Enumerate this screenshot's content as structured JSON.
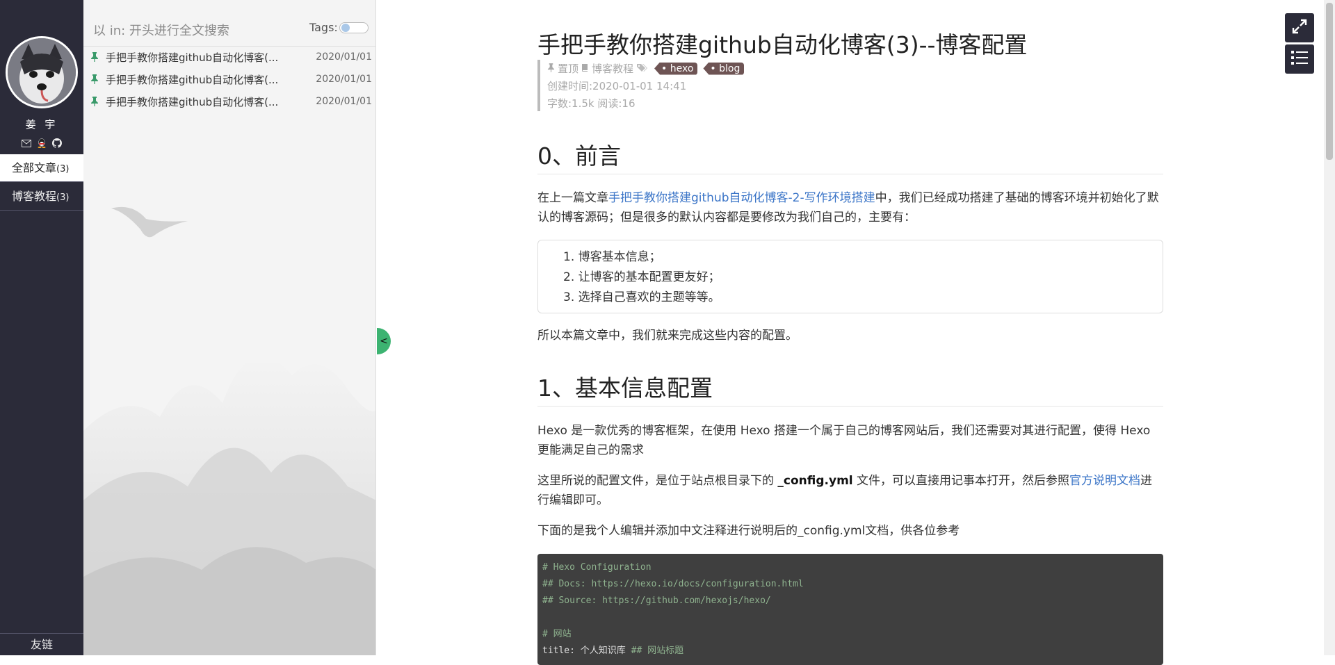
{
  "sidebar": {
    "author": "姜 宇",
    "nav": [
      {
        "label": "全部文章",
        "count": "(3)"
      },
      {
        "label": "博客教程",
        "count": "(3)"
      }
    ],
    "friends": "友链",
    "social_icons": [
      "mail-icon",
      "qq-icon",
      "github-icon"
    ]
  },
  "list": {
    "search_placeholder": "以 in: 开头进行全文搜索",
    "tags_label": "Tags:",
    "posts": [
      {
        "title": "手把手教你搭建github自动化博客(...",
        "date": "2020/01/01"
      },
      {
        "title": "手把手教你搭建github自动化博客(...",
        "date": "2020/01/01"
      },
      {
        "title": "手把手教你搭建github自动化博客(...",
        "date": "2020/01/01"
      }
    ],
    "collapse": "<"
  },
  "article": {
    "title": "手把手教你搭建github自动化博客(3)--博客配置",
    "meta": {
      "top": "置顶",
      "category": "博客教程",
      "tags": [
        "hexo",
        "blog"
      ],
      "created": "创建时间:2020-01-01 14:41",
      "stats": "字数:1.5k 阅读:16"
    },
    "sec0": "0、前言",
    "p1_pre": "在上一篇文章",
    "p1_link": "手把手教你搭建github自动化博客-2-写作环境搭建",
    "p1_post": "中，我们已经成功搭建了基础的博客环境并初始化了默认的博客源码；但是很多的默认内容都是要修改为我们自己的，主要有：",
    "list": [
      "博客基本信息；",
      "让博客的基本配置更友好；",
      "选择自己喜欢的主题等等。"
    ],
    "p2": "所以本篇文章中，我们就来完成这些内容的配置。",
    "sec1": "1、基本信息配置",
    "p3": "Hexo 是一款优秀的博客框架，在使用 Hexo 搭建一个属于自己的博客网站后，我们还需要对其进行配置，使得 Hexo 更能满足自己的需求",
    "p4_pre": "这里所说的配置文件，是位于站点根目录下的 ",
    "p4_bold": "_config.yml",
    "p4_mid": " 文件，可以直接用记事本打开，然后参照",
    "p4_link": "官方说明文档",
    "p4_post": "进行编辑即可。",
    "p5": "下面的是我个人编辑并添加中文注释进行说明后的_config.yml文档，供各位参考",
    "code": {
      "l1": "# Hexo Configuration",
      "l2": "## Docs: https://hexo.io/docs/configuration.html",
      "l3": "## Source: https://github.com/hexojs/hexo/",
      "l4": "# 网站",
      "l5_key": "title: 个人知识库 ",
      "l5_comment": "## 网站标题"
    }
  }
}
